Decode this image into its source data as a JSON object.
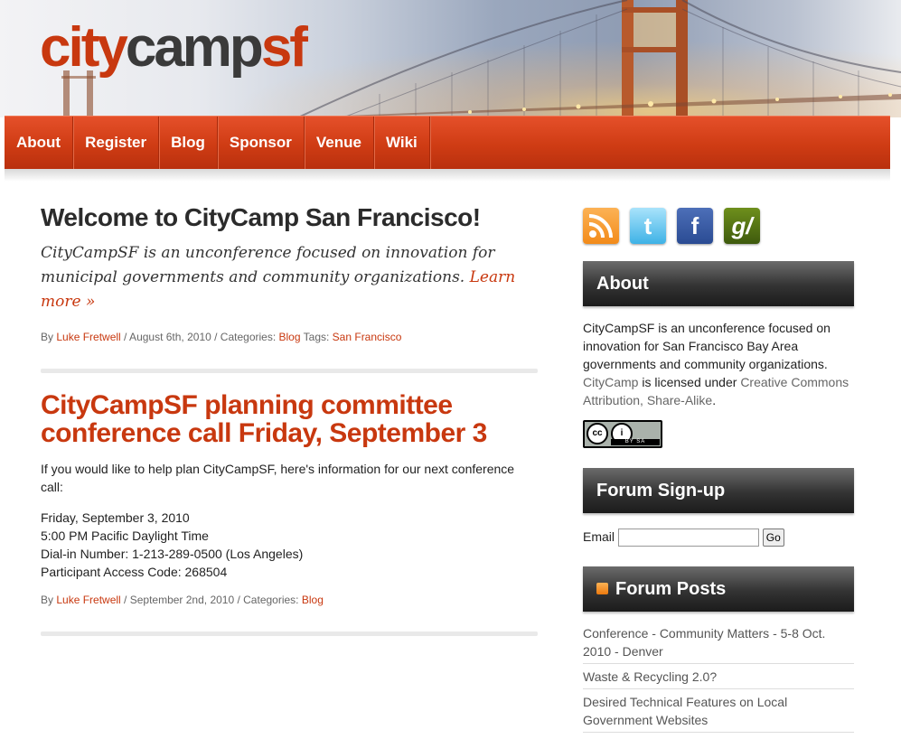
{
  "brand": {
    "logo_part1": "city",
    "logo_part2": "camp",
    "logo_part3": "sf"
  },
  "nav": {
    "items": [
      {
        "label": "About"
      },
      {
        "label": "Register"
      },
      {
        "label": "Blog"
      },
      {
        "label": "Sponsor"
      },
      {
        "label": "Venue"
      },
      {
        "label": "Wiki"
      }
    ]
  },
  "posts": [
    {
      "title": "Welcome to CityCamp San Francisco!",
      "intro": "CityCampSF is an unconference focused on innovation for municipal governments and community organizations.",
      "learn_more": "Learn more »",
      "meta": {
        "by": "By ",
        "author": "Luke Fretwell",
        "date_text": " / August 6th, 2010 / Categories: ",
        "category": "Blog",
        "tags_text": " Tags: ",
        "tag": "San Francisco"
      }
    },
    {
      "title": "CityCampSF planning committee conference call Friday, September 3",
      "paragraph": "If you would like to help plan CityCampSF, here's information for our next conference call:",
      "details": [
        "Friday, September 3, 2010",
        "5:00 PM Pacific Daylight Time",
        "Dial-in Number: 1-213-289-0500 (Los Angeles)",
        "Participant Access Code: 268504"
      ],
      "meta": {
        "by": "By ",
        "author": "Luke Fretwell",
        "date_text": " / September 2nd, 2010 / Categories: ",
        "category": "Blog"
      }
    }
  ],
  "sidebar": {
    "social": [
      {
        "icon": "rss-icon",
        "glyph": "◉"
      },
      {
        "icon": "twitter-icon",
        "glyph": "t"
      },
      {
        "icon": "facebook-icon",
        "glyph": "f"
      },
      {
        "icon": "govloop-icon",
        "glyph": "g/"
      }
    ],
    "about": {
      "heading": "About",
      "text_1": "CityCampSF is an unconference focused on innovation for San Francisco Bay Area governments and community organizations. ",
      "link_citycamp": "CityCamp",
      "text_2": " is licensed under ",
      "link_license": "Creative Commons Attribution, Share-Alike",
      "text_3": ".",
      "badge_strip": "BY   SA"
    },
    "signup": {
      "heading": "Forum Sign-up",
      "email_label": "Email",
      "email_value": "",
      "go_label": "Go"
    },
    "forum": {
      "heading": "Forum Posts",
      "items": [
        "Conference - Community Matters - 5-8 Oct. 2010 - Denver",
        "Waste & Recycling 2.0?",
        "Desired Technical Features on Local Government Websites"
      ]
    }
  },
  "colors": {
    "accent": "#c8380f",
    "nav_bg": "#cf3c14",
    "widget_header": "#333333"
  }
}
